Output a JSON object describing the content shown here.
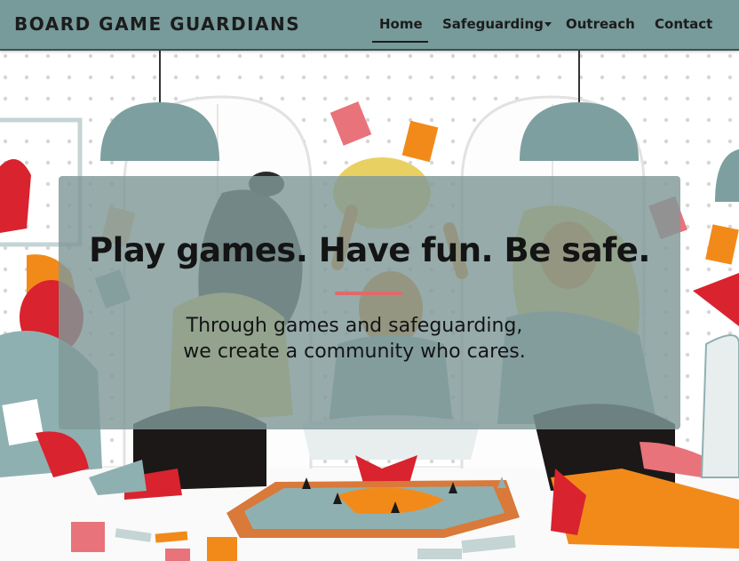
{
  "brand": "BOARD GAME GUARDIANS",
  "nav": {
    "home": "Home",
    "safeguarding": "Safeguarding",
    "outreach": "Outreach",
    "contact": "Contact"
  },
  "hero": {
    "headline": "Play games. Have fun. Be safe.",
    "subtitle_line1": "Through games and safeguarding,",
    "subtitle_line2": "we create a community who cares."
  },
  "colors": {
    "navbar": "#779a9a",
    "overlay": "#809898",
    "accent": "#e06a6a",
    "orange": "#f28a1a",
    "red": "#d9232e"
  }
}
